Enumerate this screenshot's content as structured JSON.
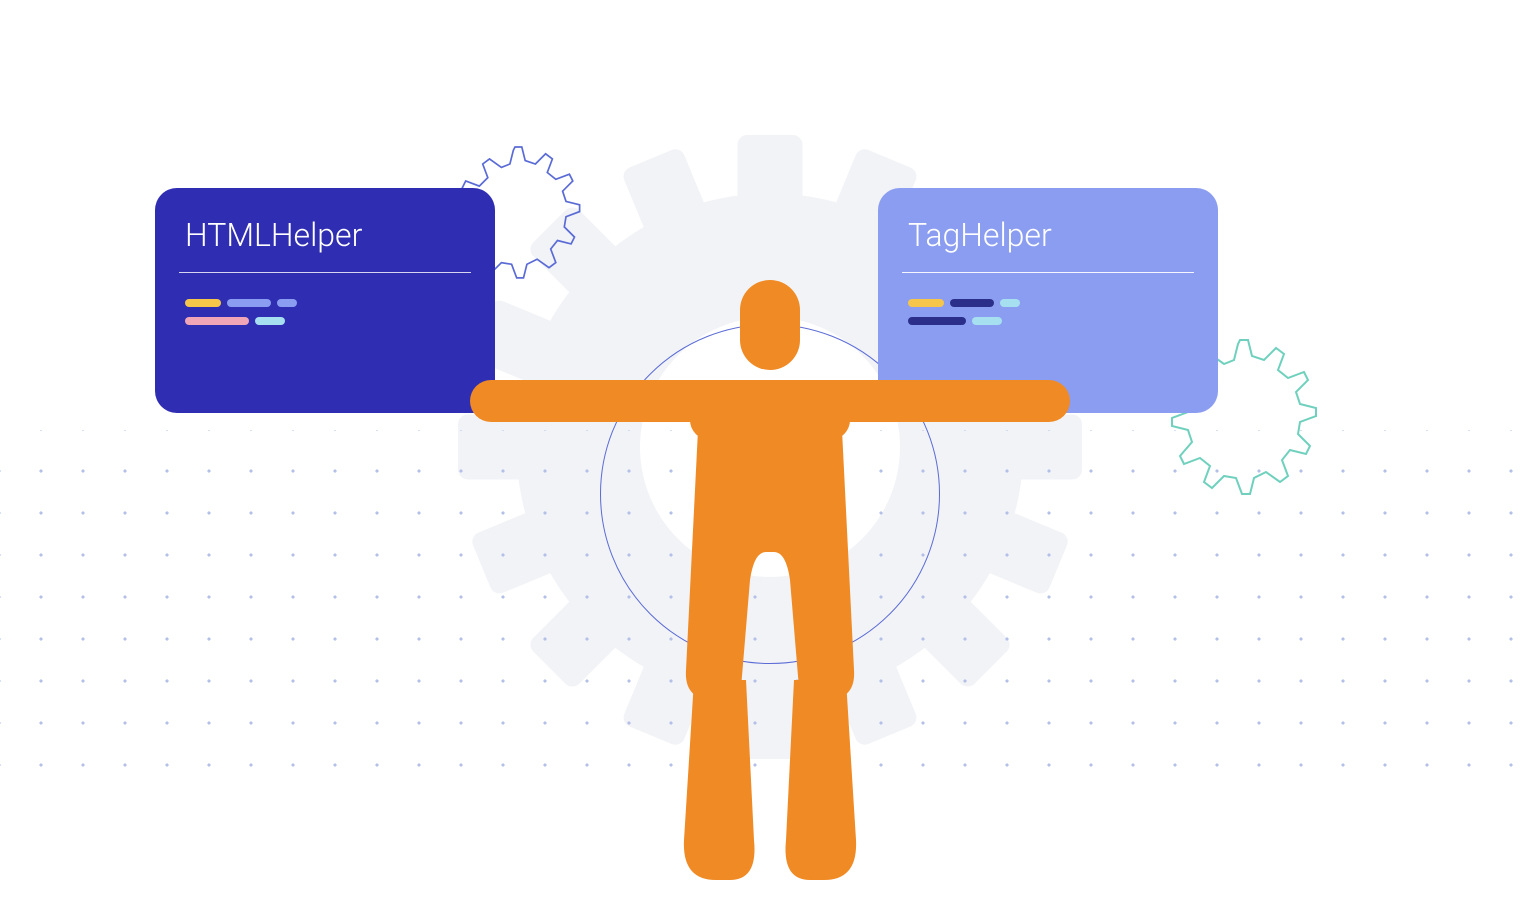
{
  "cards": {
    "left": {
      "title": "HTMLHelper",
      "bg_color": "#2f2db2"
    },
    "right": {
      "title": "TagHelper",
      "bg_color": "#8b9df0"
    }
  },
  "figure": {
    "person_color": "#f08a24",
    "gear_bg_color": "#f2f3f6",
    "ring_color": "#5a6bd6",
    "gear_outline_blue": "#5a6bd6",
    "gear_outline_teal": "#6fd1bd",
    "dot_color": "#b4c0e8"
  },
  "code_segments": {
    "yellow": "#f6c64b",
    "navy": "#2b2f8a",
    "pink": "#f0a6b6",
    "cyan": "#a6dff0"
  }
}
